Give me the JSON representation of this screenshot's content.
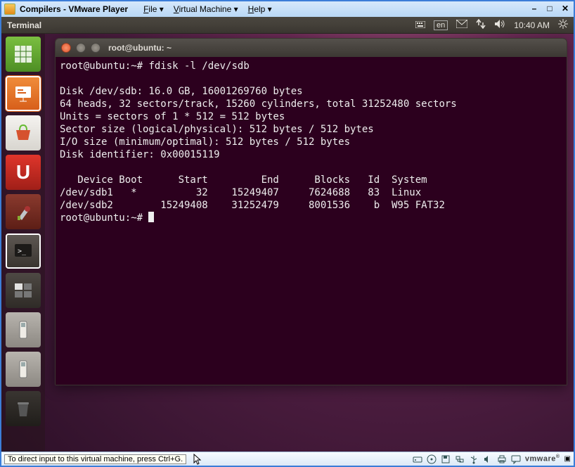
{
  "vmware": {
    "title": "Compilers - VMware Player",
    "menu": {
      "file": "File",
      "vm": "Virtual Machine",
      "help": "Help"
    },
    "status_hint": "To direct input to this virtual machine, press Ctrl+G.",
    "logo": "vmware"
  },
  "ubuntu_top": {
    "app": "Terminal",
    "lang": "en",
    "time": "10:40 AM"
  },
  "term": {
    "title": "root@ubuntu: ~",
    "prompt": "root@ubuntu:~#",
    "cmd": "fdisk -l /dev/sdb",
    "body_lines": [
      "",
      "Disk /dev/sdb: 16.0 GB, 16001269760 bytes",
      "64 heads, 32 sectors/track, 15260 cylinders, total 31252480 sectors",
      "Units = sectors of 1 * 512 = 512 bytes",
      "Sector size (logical/physical): 512 bytes / 512 bytes",
      "I/O size (minimum/optimal): 512 bytes / 512 bytes",
      "Disk identifier: 0x00015119",
      "",
      "   Device Boot      Start         End      Blocks   Id  System",
      "/dev/sdb1   *          32    15249407     7624688   83  Linux",
      "/dev/sdb2        15249408    31252479     8001536    b  W95 FAT32"
    ]
  },
  "launcher": {
    "items": [
      {
        "name": "libreoffice-calc"
      },
      {
        "name": "libreoffice-impress"
      },
      {
        "name": "software-center"
      },
      {
        "name": "ubuntu-one",
        "glyph": "U"
      },
      {
        "name": "system-settings"
      },
      {
        "name": "terminal"
      },
      {
        "name": "workspace-switcher"
      },
      {
        "name": "removable-1"
      },
      {
        "name": "removable-2"
      },
      {
        "name": "trash"
      }
    ]
  }
}
